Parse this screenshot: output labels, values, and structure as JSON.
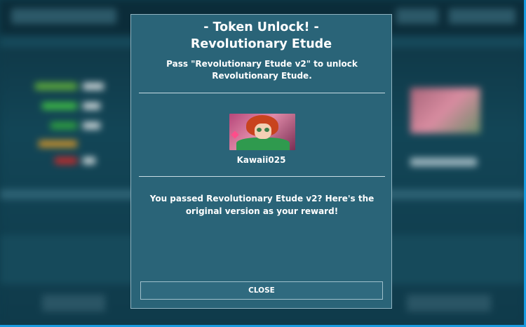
{
  "modal": {
    "title_line1": "- Token Unlock! -",
    "title_line2": "Revolutionary Etude",
    "description": "Pass \"Revolutionary Etude v2\" to unlock Revolutionary Etude.",
    "creator_name": "Kawaii025",
    "message": "You passed Revolutionary Etude v2? Here's the original version as your reward!",
    "close_label": "CLOSE",
    "avatar_icon": "anime-character-avatar"
  },
  "colors": {
    "modal_background": "#2a6478",
    "window_edge": "#1a9be0"
  }
}
